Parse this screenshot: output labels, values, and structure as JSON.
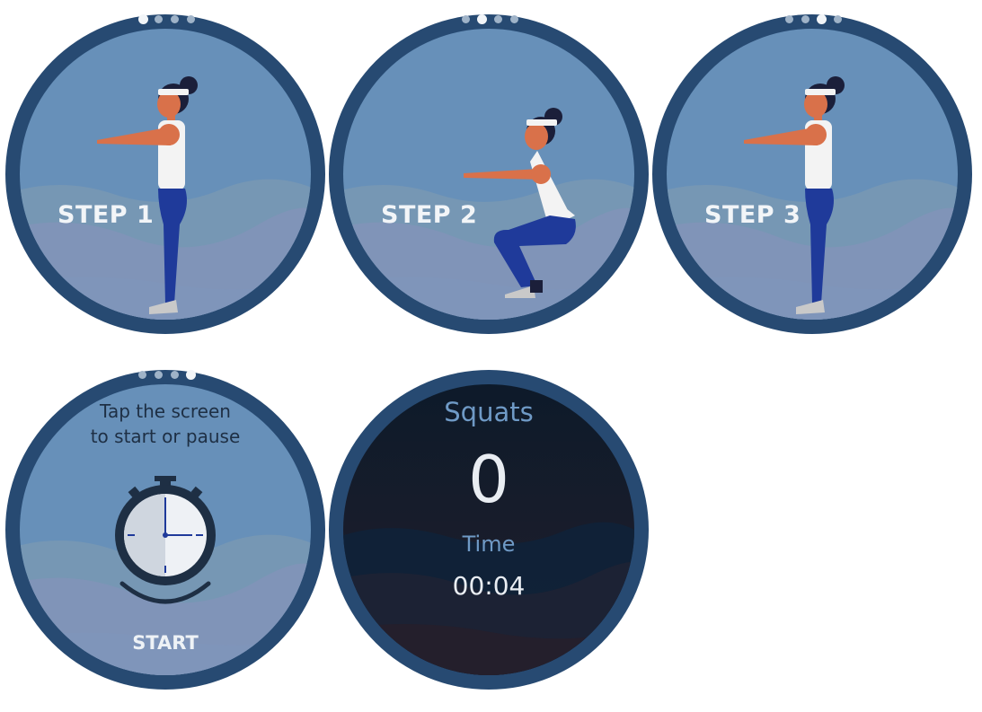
{
  "screens": {
    "step1": {
      "label": "STEP 1"
    },
    "step2": {
      "label": "STEP 2"
    },
    "step3": {
      "label": "STEP 3"
    },
    "start": {
      "instruction_line1": "Tap the screen",
      "instruction_line2": "to start or pause",
      "start_label": "START"
    },
    "result": {
      "exercise_name": "Squats",
      "count": "0",
      "time_label": "Time",
      "time_value": "00:04"
    }
  },
  "page_indicator": {
    "total": 4,
    "active_per_screen": [
      1,
      2,
      3,
      4
    ]
  },
  "colors": {
    "bezel": "#274a72",
    "sky": "#6790b9",
    "wave_mid": "#7b99b3",
    "wave_low": "#8094b8",
    "dark_face": "#0c1a2a",
    "skin": "#d9714a",
    "shirt": "#f3f3f3",
    "pants": "#1f3a9a",
    "hair": "#1b1f3a"
  }
}
